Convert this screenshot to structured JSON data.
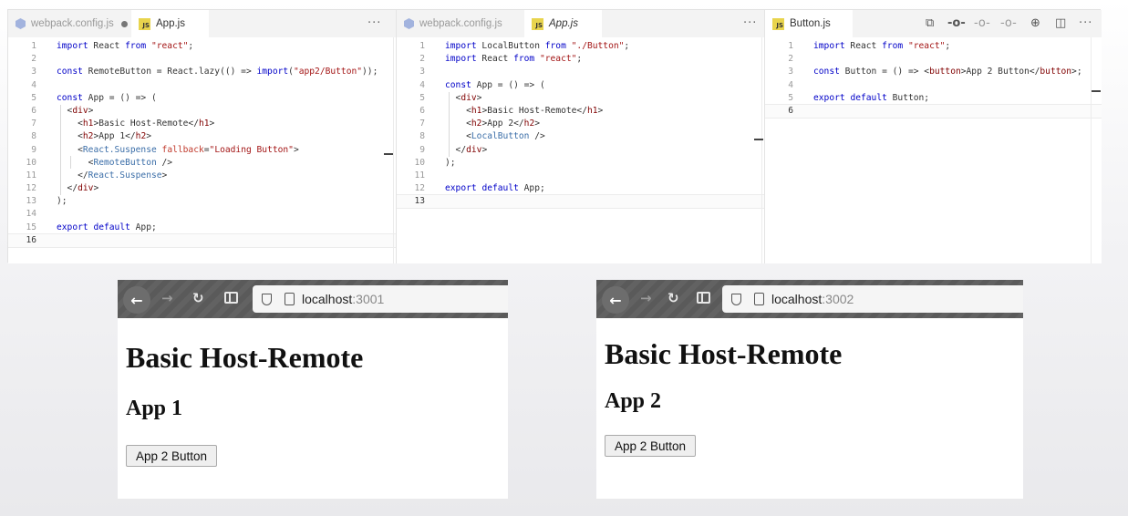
{
  "editors": {
    "left": {
      "tabs": [
        {
          "label": "webpack.config.js",
          "modified": true
        },
        {
          "label": "App.js"
        }
      ],
      "lines": [
        {
          "n": "1",
          "code": "import React from \"react\";"
        },
        {
          "n": "2",
          "code": ""
        },
        {
          "n": "3",
          "code": "const RemoteButton = React.lazy(() => import(\"app2/Button\"));"
        },
        {
          "n": "4",
          "code": ""
        },
        {
          "n": "5",
          "code": "const App = () => ("
        },
        {
          "n": "6",
          "code": "  <div>"
        },
        {
          "n": "7",
          "code": "    <h1>Basic Host-Remote</h1>"
        },
        {
          "n": "8",
          "code": "    <h2>App 1</h2>"
        },
        {
          "n": "9",
          "code": "    <React.Suspense fallback=\"Loading Button\">"
        },
        {
          "n": "10",
          "code": "      <RemoteButton />"
        },
        {
          "n": "11",
          "code": "    </React.Suspense>"
        },
        {
          "n": "12",
          "code": "  </div>"
        },
        {
          "n": "13",
          "code": ");"
        },
        {
          "n": "14",
          "code": ""
        },
        {
          "n": "15",
          "code": "export default App;"
        },
        {
          "n": "16",
          "code": ""
        }
      ]
    },
    "middle": {
      "tabs": [
        {
          "label": "webpack.config.js"
        },
        {
          "label": "App.js"
        }
      ],
      "lines": [
        {
          "n": "1",
          "code": "import LocalButton from \"./Button\";"
        },
        {
          "n": "2",
          "code": "import React from \"react\";"
        },
        {
          "n": "3",
          "code": ""
        },
        {
          "n": "4",
          "code": "const App = () => ("
        },
        {
          "n": "5",
          "code": "  <div>"
        },
        {
          "n": "6",
          "code": "    <h1>Basic Host-Remote</h1>"
        },
        {
          "n": "7",
          "code": "    <h2>App 2</h2>"
        },
        {
          "n": "8",
          "code": "    <LocalButton />"
        },
        {
          "n": "9",
          "code": "  </div>"
        },
        {
          "n": "10",
          "code": ");"
        },
        {
          "n": "11",
          "code": ""
        },
        {
          "n": "12",
          "code": "export default App;"
        },
        {
          "n": "13",
          "code": ""
        }
      ]
    },
    "right": {
      "tabs": [
        {
          "label": "Button.js"
        }
      ],
      "lines": [
        {
          "n": "1",
          "code": "import React from \"react\";"
        },
        {
          "n": "2",
          "code": ""
        },
        {
          "n": "3",
          "code": "const Button = () => <button>App 2 Button</button>;"
        },
        {
          "n": "4",
          "code": ""
        },
        {
          "n": "5",
          "code": "export default Button;"
        },
        {
          "n": "6",
          "code": ""
        }
      ],
      "toolbar_icons": [
        "compare-icon",
        "commit-icon",
        "previous-change-icon",
        "next-change-icon",
        "open-changes-icon",
        "split-editor-icon",
        "more-actions-icon"
      ]
    },
    "more_glyph": "···"
  },
  "browsers": [
    {
      "url_host": "localhost",
      "url_port": ":3001",
      "h1": "Basic Host-Remote",
      "h2": "App 1",
      "button_label": "App 2 Button"
    },
    {
      "url_host": "localhost",
      "url_port": ":3002",
      "h1": "Basic Host-Remote",
      "h2": "App 2",
      "button_label": "App 2 Button"
    }
  ],
  "colors": {
    "keyword": "#0000c8",
    "string": "#a31515",
    "tag": "#800000",
    "toolbar": "#5a5a5a",
    "js_badge": "#e8d44d"
  }
}
